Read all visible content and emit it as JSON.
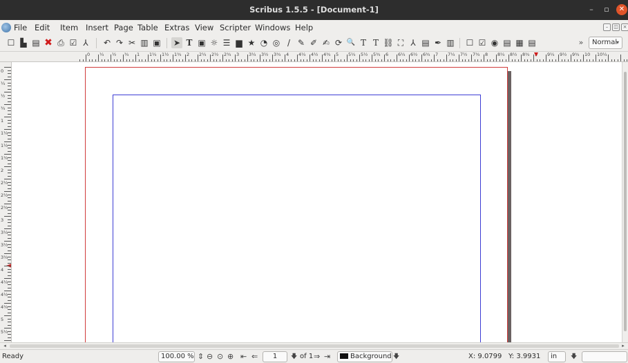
{
  "window": {
    "title": "Scribus 1.5.5 - [Document-1]",
    "minimize_glyph": "–",
    "maximize_glyph": "▫",
    "close_glyph": "✕"
  },
  "menubar": {
    "app_icon": "scribus-app-icon",
    "items": [
      "File",
      "Edit",
      "Item",
      "Insert",
      "Page",
      "Table",
      "Extras",
      "View",
      "Scripter",
      "Windows",
      "Help"
    ]
  },
  "toolbar": {
    "overflow": "»",
    "style_value": "Normal",
    "style_caret": "▾",
    "icons": {
      "new": "☐",
      "open": "▙",
      "save": "▤",
      "close": "✖",
      "print": "⎙",
      "preflight": "☑",
      "pdf": "⅄",
      "undo": "↶",
      "redo": "↷",
      "cut": "✂",
      "copy": "▥",
      "paste": "▣",
      "select": "➤",
      "text-frame": "T",
      "image-frame": "▣",
      "render-frame": "☼",
      "table": "☰",
      "shape": "▆",
      "polygon": "★",
      "arc": "◔",
      "spiral": "◎",
      "line": "/",
      "bezier": "✎",
      "freehand": "✐",
      "calligraphic": "✍",
      "rotate": "⟳",
      "zoom": "🔍",
      "edit-contents": "T",
      "edit-text": "T",
      "link-frames": "⛓",
      "unlink-frames": "⛶",
      "measure": "⅄",
      "copy-properties": "▤",
      "eyedropper": "✒",
      "pdf-button": "▥",
      "pdf-textfield": "☐",
      "pdf-checkbox": "☑",
      "pdf-radio": "◉",
      "pdf-combobox": "▤",
      "pdf-listbox": "▦",
      "pdf-annotation": "▤"
    }
  },
  "ruler": {
    "h_labels": [
      "0",
      "¼",
      "½",
      "¾",
      "1",
      "1¼",
      "1½",
      "1¾",
      "2",
      "2¼",
      "2½",
      "2¾",
      "3",
      "3¼",
      "3½",
      "3¾",
      "4",
      "4¼",
      "4½",
      "4¾",
      "5",
      "5¼",
      "5½",
      "5¾",
      "6",
      "6¼",
      "6½",
      "6¾",
      "7",
      "7¼",
      "7½",
      "7¾",
      "8",
      "8¼",
      "8½",
      "8¾",
      "9",
      "9¼",
      "9½",
      "9¾",
      "10",
      "10¼"
    ],
    "v_labels": [
      "0",
      "¼",
      "½",
      "¾",
      "1",
      "1¼",
      "1½",
      "1¾",
      "2",
      "2¼",
      "2½",
      "2¾",
      "3",
      "3¼",
      "3½",
      "3¾",
      "4",
      "4¼",
      "4½",
      "4¾",
      "5",
      "5¼"
    ]
  },
  "statusbar": {
    "status": "Ready",
    "zoom": "100.00 %",
    "page_current": "1",
    "page_of": "of 1",
    "layer": "Background",
    "x_label": "X: 9.0799",
    "y_label": "Y: 3.9931",
    "unit": "in",
    "icons": {
      "spin": "⇕",
      "zoom-out": "⊖",
      "zoom-100": "⊙",
      "zoom-in": "⊕",
      "first": "⇤",
      "prev": "⇐",
      "next": "⇒",
      "last": "⇥",
      "dropdown": "🡇"
    }
  },
  "scrollbar": {
    "left_arrow": "◂",
    "right_arrow": "▸"
  },
  "colors": {
    "titlebar": "#2d2d2d",
    "chrome": "#efeeec",
    "page_border": "#d03a3a",
    "margin_guide": "#3b3bd4",
    "close_button": "#e0542a"
  }
}
